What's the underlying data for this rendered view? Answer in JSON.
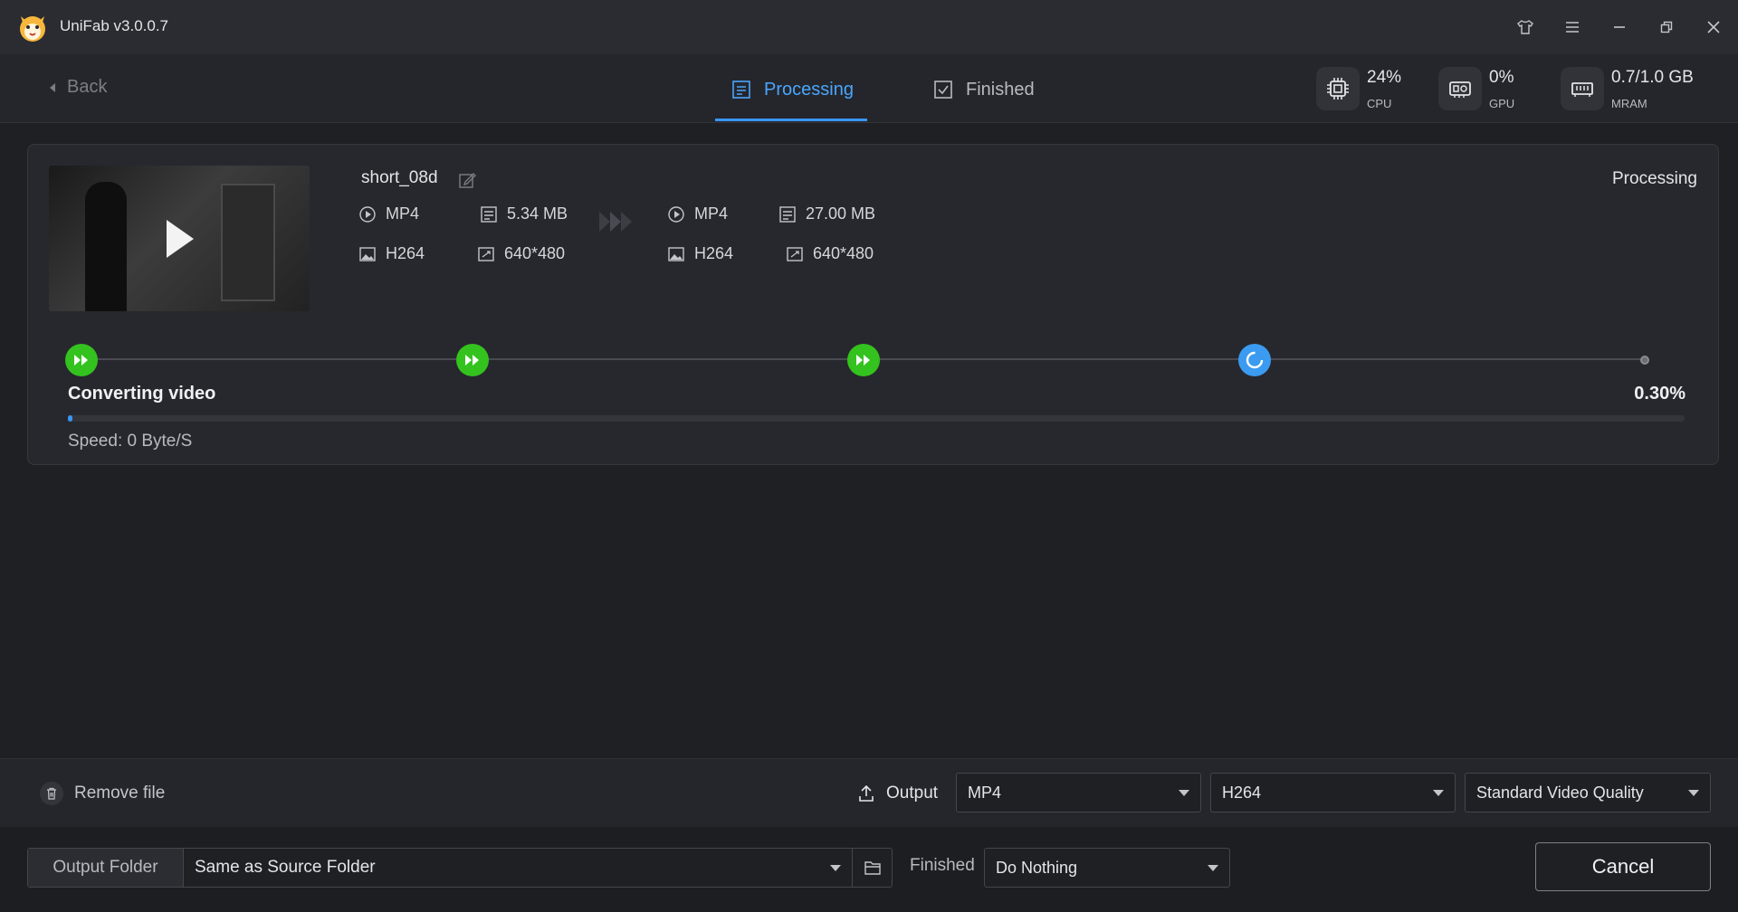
{
  "app": {
    "title": "UniFab v3.0.0.7"
  },
  "nav": {
    "back_label": "Back",
    "tabs": [
      {
        "label": "Processing",
        "active": true
      },
      {
        "label": "Finished",
        "active": false
      }
    ]
  },
  "stats": {
    "cpu": {
      "value": "24%",
      "label": "CPU"
    },
    "gpu": {
      "value": "0%",
      "label": "GPU"
    },
    "mram": {
      "value": "0.7/1.0 GB",
      "label": "MRAM"
    }
  },
  "task": {
    "filename": "short_08d",
    "status": "Processing",
    "source": {
      "format": "MP4",
      "size": "5.34 MB",
      "codec": "H264",
      "resolution": "640*480"
    },
    "target": {
      "format": "MP4",
      "size": "27.00 MB",
      "codec": "H264",
      "resolution": "640*480"
    },
    "steps_completed": 3,
    "step_label": "Converting video",
    "percent_text": "0.30%",
    "progress_fraction": 0.003,
    "speed": "Speed: 0 Byte/S"
  },
  "bottom": {
    "remove_label": "Remove file",
    "output_label": "Output",
    "format_select": "MP4",
    "codec_select": "H264",
    "quality_select": "Standard Video Quality",
    "folder_label": "Output Folder",
    "folder_value": "Same as Source Folder",
    "finished_label": "Finished",
    "finished_action": "Do Nothing",
    "cancel_label": "Cancel"
  },
  "colors": {
    "accent": "#3a96f5",
    "done_green": "#34c21e",
    "background": "#1f2024"
  }
}
